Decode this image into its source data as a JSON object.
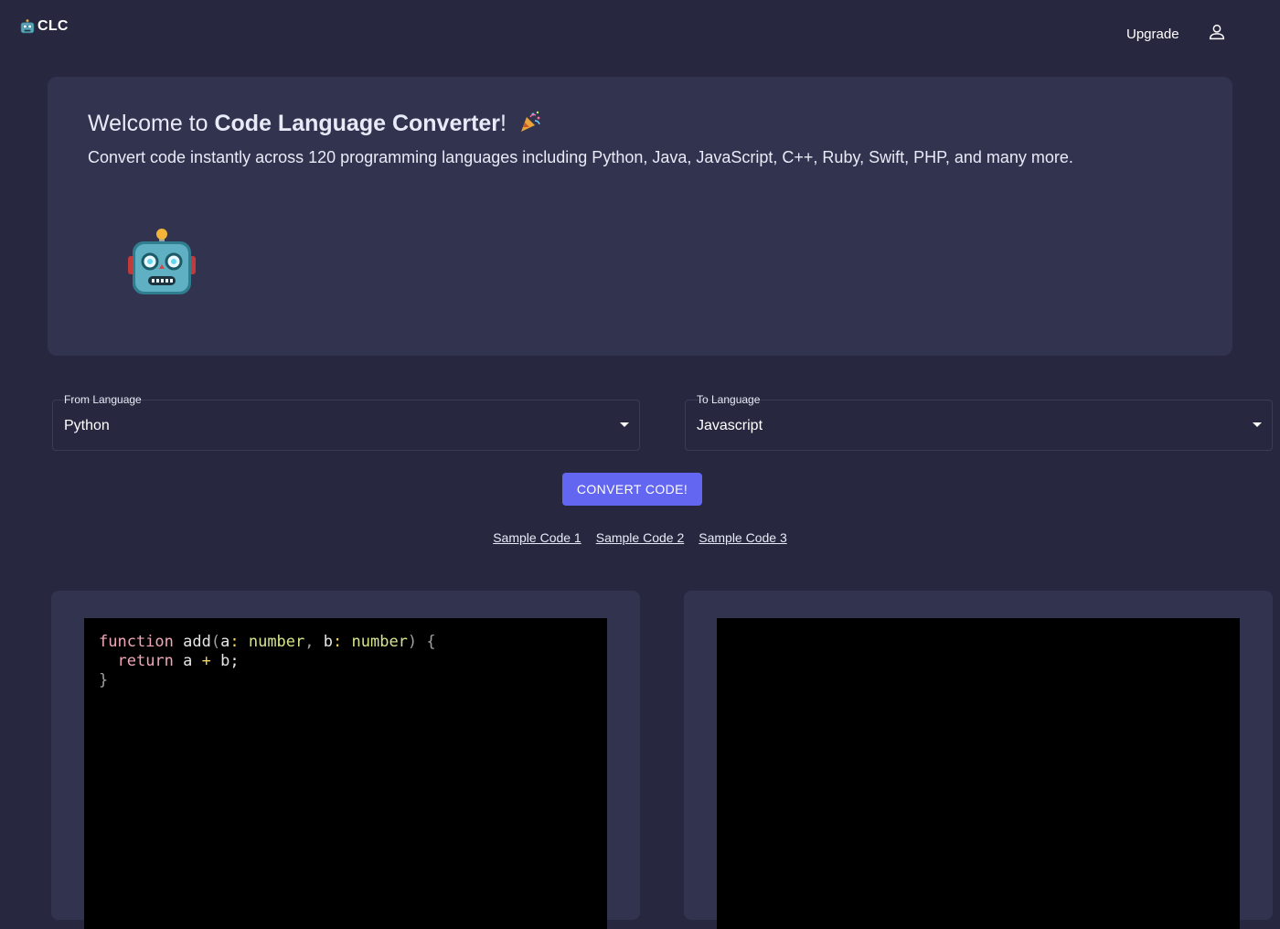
{
  "header": {
    "brand": "CLC",
    "brand_icon": "robot-icon",
    "upgrade_label": "Upgrade",
    "account_icon": "user-icon"
  },
  "hero": {
    "title_prefix": "Welcome to ",
    "title_bold": "Code Language Converter",
    "title_suffix": "!",
    "title_icon": "party-popper-icon",
    "subtitle": "Convert code instantly across 120 programming languages including Python, Java, JavaScript, C++, Ruby, Swift, PHP, and many more.",
    "illustration": "robot-icon"
  },
  "from_language": {
    "label": "From Language",
    "value": "Python"
  },
  "to_language": {
    "label": "To Language",
    "value": "Javascript"
  },
  "convert_label": "CONVERT CODE!",
  "samples": [
    "Sample Code 1",
    "Sample Code 2",
    "Sample Code 3"
  ],
  "input_editor": {
    "lines": [
      [
        [
          "kw",
          "function"
        ],
        [
          "tx",
          " add"
        ],
        [
          "pn",
          "("
        ],
        [
          "tx",
          "a"
        ],
        [
          "op",
          ":"
        ],
        [
          "tx",
          " "
        ],
        [
          "ty",
          "number"
        ],
        [
          "pn",
          ","
        ],
        [
          "tx",
          " b"
        ],
        [
          "op",
          ":"
        ],
        [
          "tx",
          " "
        ],
        [
          "ty",
          "number"
        ],
        [
          "pn",
          ")"
        ],
        [
          "tx",
          " "
        ],
        [
          "pn",
          "{"
        ]
      ],
      [
        [
          "tx",
          "  "
        ],
        [
          "kw",
          "return"
        ],
        [
          "tx",
          " a "
        ],
        [
          "op",
          "+"
        ],
        [
          "tx",
          " b;"
        ]
      ],
      [
        [
          "pn",
          "}"
        ]
      ]
    ]
  },
  "output_editor": {
    "lines": []
  },
  "colors": {
    "background": "#27283f",
    "card": "#32334f",
    "accent": "#6366f1",
    "editor_bg": "#000000"
  }
}
